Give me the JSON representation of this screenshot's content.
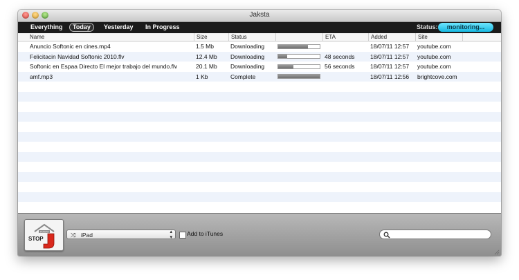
{
  "window": {
    "title": "Jaksta"
  },
  "tabs": [
    {
      "label": "Everything",
      "selected": false
    },
    {
      "label": "Today",
      "selected": true
    },
    {
      "label": "Yesterday",
      "selected": false
    },
    {
      "label": "In Progress",
      "selected": false
    }
  ],
  "status": {
    "label": "Status:",
    "value": "monitoring..."
  },
  "table": {
    "columns": [
      "Name",
      "Size",
      "Status",
      "",
      "ETA",
      "Added",
      "Site"
    ],
    "rows": [
      {
        "name": "Anuncio Softonic en cines.mp4",
        "size": "1.5 Mb",
        "status": "Downloading",
        "progress": 0.72,
        "eta": "",
        "added": "18/07/11 12:57",
        "site": "youtube.com"
      },
      {
        "name": "Felicitacin Navidad Softonic 2010.flv",
        "size": "12.4 Mb",
        "status": "Downloading",
        "progress": 0.22,
        "eta": "48 seconds",
        "added": "18/07/11 12:57",
        "site": "youtube.com"
      },
      {
        "name": "Softonic en Espaa Directo El mejor trabajo del mundo.flv",
        "size": "20.1 Mb",
        "status": "Downloading",
        "progress": 0.36,
        "eta": "56 seconds",
        "added": "18/07/11 12:57",
        "site": "youtube.com"
      },
      {
        "name": "amf.mp3",
        "size": "1 Kb",
        "status": "Complete",
        "progress": 1.0,
        "eta": "",
        "added": "18/07/11 12:56",
        "site": "brightcove.com"
      }
    ]
  },
  "bottom": {
    "stop_label": "STOP",
    "device": "iPad",
    "itunes_label": "Add to iTunes",
    "search_placeholder": ""
  },
  "colors": {
    "status_pill": "#17b8e0",
    "toolbar": "#1b1b1b",
    "stripe": "#eef3fb"
  },
  "icons": [
    "shuffle-icon",
    "search-icon",
    "stop-j-icon",
    "select-arrows-icon"
  ]
}
